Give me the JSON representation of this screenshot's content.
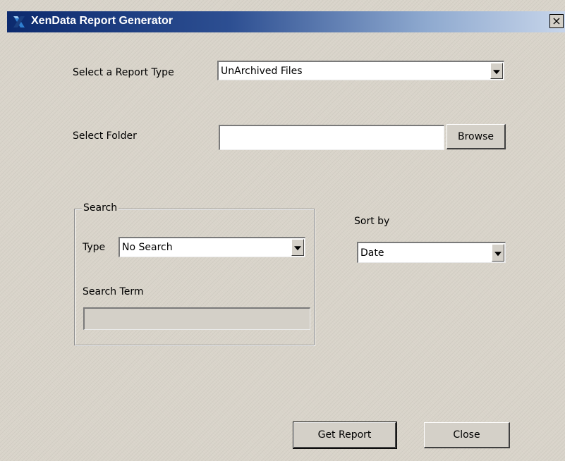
{
  "window": {
    "title": "XenData Report Generator",
    "close_glyph": "×"
  },
  "report_type": {
    "label": "Select a Report Type",
    "value": "UnArchived Files"
  },
  "folder": {
    "label": "Select Folder",
    "value": "",
    "browse_label": "Browse"
  },
  "search": {
    "group_label": "Search",
    "type_label": "Type",
    "type_value": "No Search",
    "term_label": "Search Term",
    "term_value": ""
  },
  "sort": {
    "label": "Sort by",
    "value": "Date"
  },
  "actions": {
    "get_report_label": "Get Report",
    "close_label": "Close"
  },
  "icons": {
    "app_logo": "xendata-logo-icon",
    "dropdown": "chevron-down-icon"
  },
  "colors": {
    "titlebar_start": "#0c2a6e",
    "titlebar_end": "#c7d5ea",
    "dialog_background": "#d9d4ca"
  }
}
